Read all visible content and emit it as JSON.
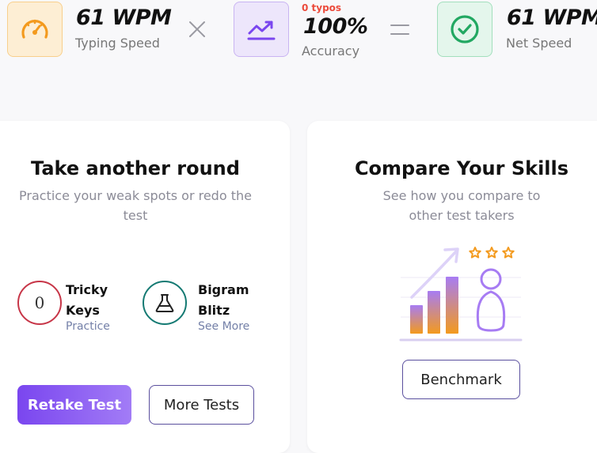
{
  "stats": {
    "typing_speed": {
      "value": "61 WPM",
      "label": "Typing Speed",
      "icon": "speedometer-icon"
    },
    "accuracy": {
      "typos": "0 typos",
      "value": "100%",
      "label": "Accuracy",
      "icon": "trending-up-icon"
    },
    "net_speed": {
      "value": "61 WPM",
      "label": "Net Speed",
      "icon": "check-circle-icon"
    }
  },
  "practice_card": {
    "title": "Take another round",
    "subtitle": "Practice your weak spots or redo the test",
    "items": [
      {
        "title": "Tricky Keys",
        "link": "Practice",
        "glyph": "0"
      },
      {
        "title": "Bigram Blitz",
        "link": "See More",
        "icon": "flask-icon"
      }
    ],
    "retake_label": "Retake Test",
    "more_label": "More Tests"
  },
  "compare_card": {
    "title": "Compare Your Skills",
    "subtitle": "See how you compare to other test takers",
    "benchmark_label": "Benchmark"
  },
  "colors": {
    "orange": "#f39a1e",
    "purple": "#7a46ef",
    "green": "#22a862",
    "red_accent": "#c73648",
    "teal_accent": "#157a73"
  }
}
